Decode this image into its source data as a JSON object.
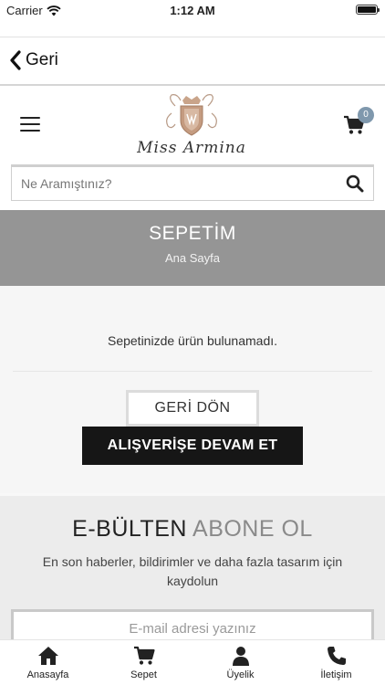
{
  "status_bar": {
    "carrier": "Carrier",
    "time": "1:12 AM"
  },
  "nav": {
    "back_label": "Geri"
  },
  "header": {
    "logo_text": "Miss Armina",
    "cart_count": "0"
  },
  "search": {
    "placeholder": "Ne Aramıştınız?"
  },
  "banner": {
    "title": "SEPETİM",
    "breadcrumb": "Ana Sayfa"
  },
  "cart": {
    "empty_message": "Sepetinizde ürün bulunamadı.",
    "back_button": "GERİ DÖN",
    "continue_button": "ALIŞVERİŞE DEVAM ET"
  },
  "newsletter": {
    "title_dark": "E-BÜLTEN",
    "title_light": "ABONE OL",
    "description": "En son haberler, bildirimler ve daha fazla tasarım için kaydolun",
    "email_placeholder": "E-mail adresi yazınız"
  },
  "tabs": [
    {
      "label": "Anasayfa",
      "icon": "home-icon"
    },
    {
      "label": "Sepet",
      "icon": "cart-icon"
    },
    {
      "label": "Üyelik",
      "icon": "user-icon"
    },
    {
      "label": "İletişim",
      "icon": "phone-icon"
    }
  ],
  "colors": {
    "banner_bg": "#959595",
    "badge": "#7f98ad",
    "button_dark": "#161616"
  }
}
